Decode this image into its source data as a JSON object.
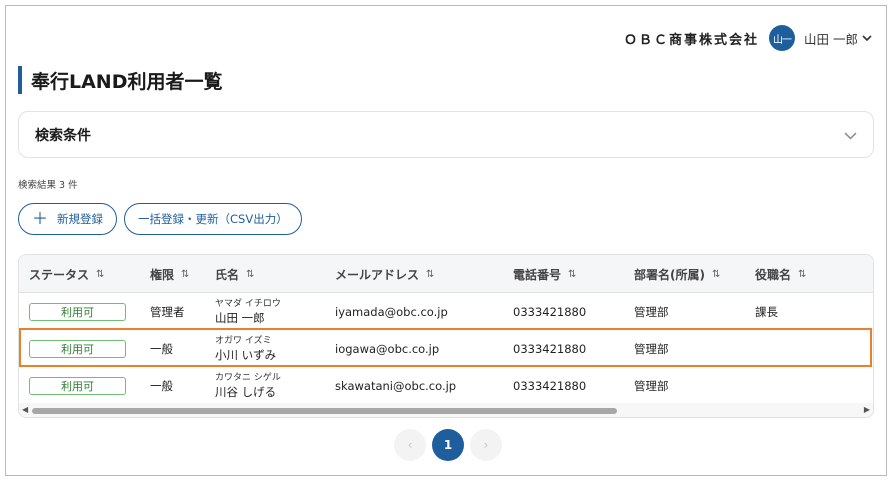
{
  "header": {
    "company": "ＯＢＣ商事株式会社",
    "avatar_text": "山一",
    "user_name": "山田 一郎"
  },
  "page": {
    "title": "奉行LAND利用者一覧"
  },
  "search": {
    "label": "検索条件"
  },
  "results": {
    "count_text": "検索結果 3 件"
  },
  "actions": {
    "new_label": "新規登録",
    "bulk_label": "一括登録・更新（CSV出力）"
  },
  "table": {
    "columns": {
      "status": "ステータス",
      "role": "権限",
      "name": "氏名",
      "email": "メールアドレス",
      "phone": "電話番号",
      "dept": "部署名(所属)",
      "title": "役職名"
    },
    "sort_icon": "⇅",
    "rows": [
      {
        "status": "利用可",
        "role": "管理者",
        "kana": "ヤマダ イチロウ",
        "name": "山田 一郎",
        "email": "iyamada@obc.co.jp",
        "phone": "0333421880",
        "dept": "管理部",
        "title": "課長"
      },
      {
        "status": "利用可",
        "role": "一般",
        "kana": "オガワ イズミ",
        "name": "小川 いずみ",
        "email": "iogawa@obc.co.jp",
        "phone": "0333421880",
        "dept": "管理部",
        "title": ""
      },
      {
        "status": "利用可",
        "role": "一般",
        "kana": "カワタニ シゲル",
        "name": "川谷 しげる",
        "email": "skawatani@obc.co.jp",
        "phone": "0333421880",
        "dept": "管理部",
        "title": ""
      }
    ],
    "horizontal_scroll_position": 0.0
  },
  "pagination": {
    "prev": "‹",
    "current": "1",
    "next": "›"
  },
  "colors": {
    "primary": "#1f5e9c",
    "status_green": "#2e7d32",
    "highlight": "#e8812a"
  }
}
